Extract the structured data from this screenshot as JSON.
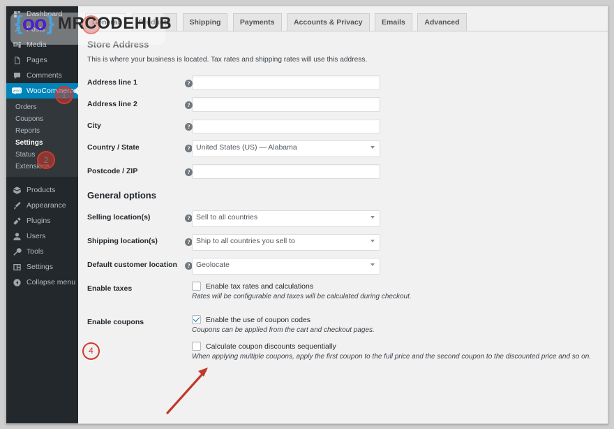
{
  "watermark": {
    "logo_left": "{",
    "logo_center": "oo",
    "logo_right": "}",
    "text": "MRCODEHUB"
  },
  "sidebar": {
    "items": [
      {
        "label": "Dashboard",
        "icon": "dashboard-icon"
      },
      {
        "label": "Posts",
        "icon": "pin-icon"
      },
      {
        "label": "Media",
        "icon": "media-icon"
      },
      {
        "label": "Pages",
        "icon": "pages-icon"
      },
      {
        "label": "Comments",
        "icon": "comments-icon"
      },
      {
        "label": "WooCommerce",
        "icon": "woocommerce-icon"
      }
    ],
    "woocommerce_submenu": [
      {
        "label": "Orders"
      },
      {
        "label": "Coupons"
      },
      {
        "label": "Reports"
      },
      {
        "label": "Settings"
      },
      {
        "label": "Status"
      },
      {
        "label": "Extensions"
      }
    ],
    "lower_items": [
      {
        "label": "Products",
        "icon": "products-icon"
      },
      {
        "label": "Appearance",
        "icon": "appearance-icon"
      },
      {
        "label": "Plugins",
        "icon": "plugins-icon"
      },
      {
        "label": "Users",
        "icon": "users-icon"
      },
      {
        "label": "Tools",
        "icon": "tools-icon"
      },
      {
        "label": "Settings",
        "icon": "settings-icon"
      },
      {
        "label": "Collapse menu",
        "icon": "collapse-icon"
      }
    ],
    "active_item": "WooCommerce",
    "active_subitem": "Settings",
    "accent_color": "#0085ba",
    "background_color": "#23282d"
  },
  "tabs": [
    {
      "label": "General",
      "active": true
    },
    {
      "label": "Products",
      "active": false
    },
    {
      "label": "Shipping",
      "active": false
    },
    {
      "label": "Payments",
      "active": false
    },
    {
      "label": "Accounts & Privacy",
      "active": false
    },
    {
      "label": "Emails",
      "active": false
    },
    {
      "label": "Advanced",
      "active": false
    }
  ],
  "store_address": {
    "heading": "Store Address",
    "description": "This is where your business is located. Tax rates and shipping rates will use this address.",
    "fields": [
      {
        "label": "Address line 1",
        "value": "",
        "type": "text",
        "help": "?"
      },
      {
        "label": "Address line 2",
        "value": "",
        "type": "text",
        "help": "?"
      },
      {
        "label": "City",
        "value": "",
        "type": "text",
        "help": "?"
      },
      {
        "label": "Country / State",
        "value": "United States (US) — Alabama",
        "type": "select",
        "help": "?"
      },
      {
        "label": "Postcode / ZIP",
        "value": "",
        "type": "text",
        "help": "?"
      }
    ]
  },
  "general_options": {
    "heading": "General options",
    "selects": [
      {
        "label": "Selling location(s)",
        "value": "Sell to all countries"
      },
      {
        "label": "Shipping location(s)",
        "value": "Ship to all countries you sell to"
      },
      {
        "label": "Default customer location",
        "value": "Geolocate"
      }
    ],
    "enable_taxes": {
      "label": "Enable taxes",
      "checkbox_label": "Enable tax rates and calculations",
      "checked": false,
      "hint": "Rates will be configurable and taxes will be calculated during checkout."
    },
    "enable_coupons": {
      "label": "Enable coupons",
      "checkbox_label": "Enable the use of coupon codes",
      "checked": true,
      "hint": "Coupons can be applied from the cart and checkout pages.",
      "secondary_checkbox_label": "Calculate coupon discounts sequentially",
      "secondary_checked": false,
      "secondary_hint": "When applying multiple coupons, apply the first coupon to the full price and the second coupon to the discounted price and so on."
    }
  },
  "annotations": {
    "markers": [
      {
        "number": "1",
        "target": "WooCommerce menu item"
      },
      {
        "number": "2",
        "target": "Settings submenu item"
      },
      {
        "number": "3",
        "target": "General tab"
      },
      {
        "number": "4",
        "target": "Enable coupons row"
      }
    ],
    "arrow_color": "#c0392b",
    "marker_color": "#d0392b"
  }
}
